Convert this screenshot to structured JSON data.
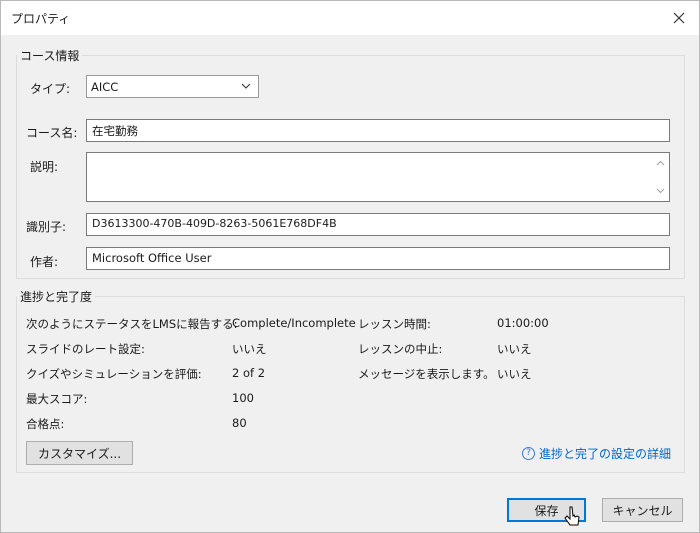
{
  "dialog": {
    "title": "プロパティ"
  },
  "course_info": {
    "legend": "コース情報",
    "type_label": "タイプ:",
    "type_value": "AICC",
    "name_label": "コース名:",
    "name_value": "在宅勤務",
    "desc_label": "説明:",
    "desc_value": "",
    "id_label": "識別子:",
    "id_value": "D3613300-470B-409D-8263-5061E768DF4B",
    "author_label": "作者:",
    "author_value": "Microsoft Office User"
  },
  "progress": {
    "legend": "進捗と完了度",
    "rows_left": [
      {
        "label": "次のようにステータスをLMSに報告する:",
        "value": "Complete/Incomplete"
      },
      {
        "label": "スライドのレート設定:",
        "value": "いいえ"
      },
      {
        "label": "クイズやシミュレーションを評価:",
        "value": "2 of 2"
      },
      {
        "label": "最大スコア:",
        "value": "100"
      },
      {
        "label": "合格点:",
        "value": "80"
      }
    ],
    "rows_right": [
      {
        "label": "レッスン時間:",
        "value": "01:00:00"
      },
      {
        "label": "レッスンの中止:",
        "value": "いいえ"
      },
      {
        "label": "メッセージを表示します。",
        "value": "いいえ"
      }
    ],
    "customize_label": "カスタマイズ...",
    "help_link": "進捗と完了の設定の詳細",
    "help_icon_glyph": "?"
  },
  "footer": {
    "save_label": "保存",
    "cancel_label": "キャンセル"
  },
  "icons": {
    "close": "close-icon",
    "chevron": "chevron-down-icon",
    "cursor": "mouse-pointer-icon"
  }
}
